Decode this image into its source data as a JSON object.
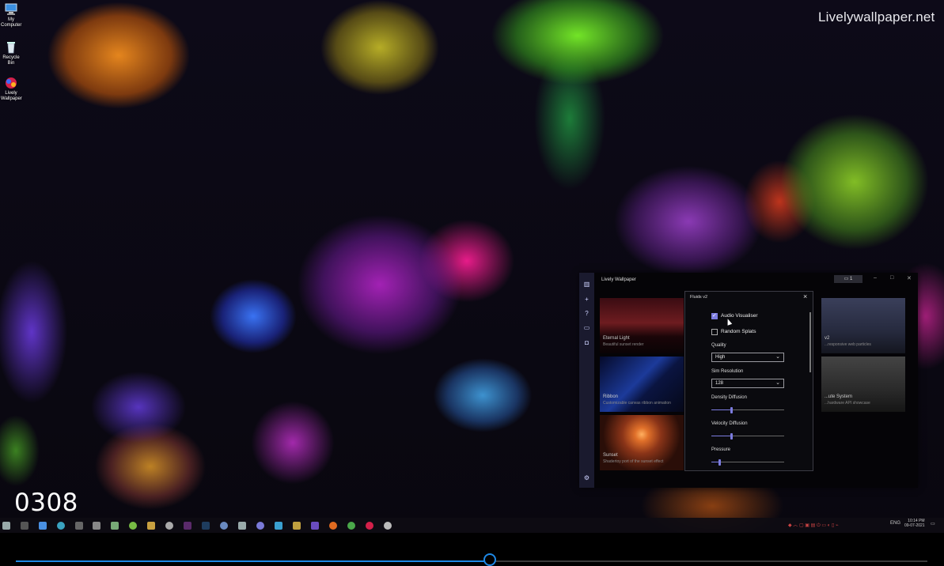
{
  "desktop": {
    "icons": [
      {
        "label": "My Computer",
        "icon": "computer-icon"
      },
      {
        "label": "Recycle Bin",
        "icon": "recycle-bin-icon"
      },
      {
        "label": "Lively Wallpaper",
        "icon": "lively-app-icon"
      }
    ],
    "watermark": "Livelywallpaper.net",
    "frame_counter": "0308"
  },
  "lively_window": {
    "title": "Lively Wallpaper",
    "monitor_button": "1",
    "wallpapers": [
      {
        "title": "Eternal Light",
        "description": "Beautiful sunset render"
      },
      {
        "title": "Ribbon",
        "description": "Customizable canvas ribbon animation"
      },
      {
        "title": "Sunset",
        "description": "Shadertoy port of the sunset effect"
      },
      {
        "title": "v2",
        "description": "...responsive web particles"
      },
      {
        "title": "...ute System",
        "description": "...hardware API showcase"
      }
    ]
  },
  "fluids_dialog": {
    "title": "Fluids v2",
    "audio_visualiser": {
      "label": "Audio Visualiser",
      "checked": true
    },
    "random_splats": {
      "label": "Random Splats",
      "checked": false
    },
    "quality": {
      "label": "Quality",
      "value": "High"
    },
    "sim_resolution": {
      "label": "Sim Resolution",
      "value": "128"
    },
    "density_diffusion": {
      "label": "Density Diffusion",
      "value": 0.27
    },
    "velocity_diffusion": {
      "label": "Velocity Diffusion",
      "value": 0.27
    },
    "pressure": {
      "label": "Pressure",
      "value": 0.11
    }
  },
  "taskbar": {
    "language": "ENG",
    "time": "10:14 PM",
    "date": "09-07-2021"
  },
  "player": {
    "progress": 0.52
  },
  "colors": {
    "accent": "#7c7ce0",
    "seek": "#1e88e5"
  }
}
